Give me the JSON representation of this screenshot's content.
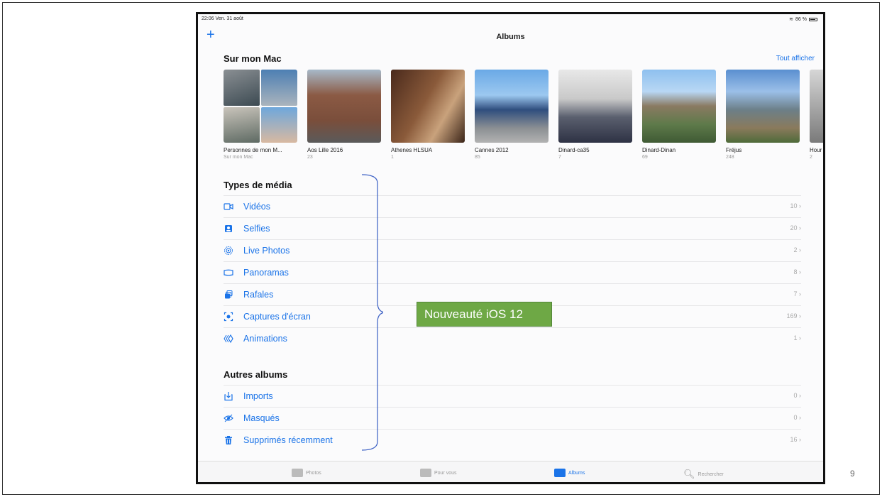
{
  "status": {
    "time": "22:06",
    "date": "Ven. 31 août",
    "battery": "86 %"
  },
  "nav": {
    "add": "+",
    "title": "Albums"
  },
  "my_mac": {
    "title": "Sur mon Mac",
    "see_all": "Tout afficher",
    "albums": [
      {
        "name": "Personnes de mon M...",
        "count": "Sur mon Mac"
      },
      {
        "name": "Aos Lille 2016",
        "count": "23"
      },
      {
        "name": "Athenes HLSUA",
        "count": "1"
      },
      {
        "name": "Cannes 2012",
        "count": "85"
      },
      {
        "name": "Dinard-ca35",
        "count": "7"
      },
      {
        "name": "Dinard-Dinan",
        "count": "69"
      },
      {
        "name": "Fréjus",
        "count": "248"
      },
      {
        "name": "Hour",
        "count": "2"
      }
    ]
  },
  "media_types": {
    "title": "Types de média",
    "rows": [
      {
        "label": "Vidéos",
        "count": "10",
        "icon": "video-icon"
      },
      {
        "label": "Selfies",
        "count": "20",
        "icon": "selfie-icon"
      },
      {
        "label": "Live Photos",
        "count": "2",
        "icon": "live-photo-icon"
      },
      {
        "label": "Panoramas",
        "count": "8",
        "icon": "panorama-icon"
      },
      {
        "label": "Rafales",
        "count": "7",
        "icon": "burst-icon"
      },
      {
        "label": "Captures d'écran",
        "count": "169",
        "icon": "screenshot-icon"
      },
      {
        "label": "Animations",
        "count": "1",
        "icon": "animation-icon"
      }
    ]
  },
  "other_albums": {
    "title": "Autres albums",
    "rows": [
      {
        "label": "Imports",
        "count": "0",
        "icon": "import-icon"
      },
      {
        "label": "Masqués",
        "count": "0",
        "icon": "hidden-eye-icon"
      },
      {
        "label": "Supprimés récemment",
        "count": "16",
        "icon": "trash-icon"
      }
    ]
  },
  "tabs": [
    {
      "label": "Photos"
    },
    {
      "label": "Pour vous"
    },
    {
      "label": "Albums"
    },
    {
      "label": "Rechercher"
    }
  ],
  "callout": {
    "text": "Nouveauté iOS 12"
  },
  "slide": {
    "number": "9"
  },
  "colors": {
    "accent": "#1a73e8",
    "callout": "#6ea845"
  }
}
